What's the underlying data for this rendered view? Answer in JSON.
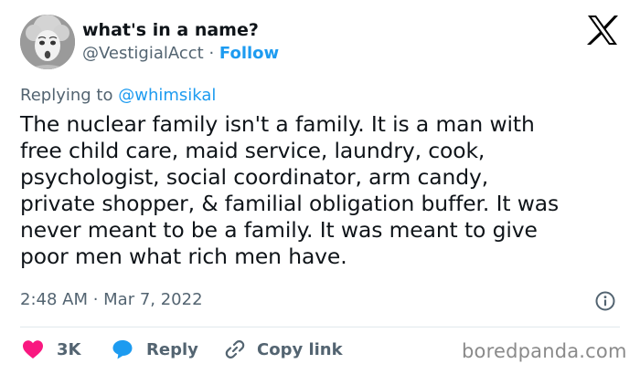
{
  "author": {
    "display_name": "what's in a name?",
    "handle": "@VestigialAcct",
    "separator": " · ",
    "follow_label": "Follow"
  },
  "reply_context": {
    "prefix": "Replying to",
    "mention": "@whimsikal"
  },
  "tweet": {
    "lines": [
      "The nuclear family isn't a family. It is a man with",
      "free child care, maid service, laundry, cook,",
      "psychologist, social coordinator, arm candy,",
      "private shopper, & familial obligation buffer. It was",
      "never meant to be a family. It was meant to give",
      "poor men what rich men have."
    ],
    "timestamp": "2:48 AM · Mar 7, 2022"
  },
  "actions": {
    "like_count": "3K",
    "reply_label": "Reply",
    "copy_label": "Copy link"
  },
  "watermark": "boredpanda.com",
  "colors": {
    "like": "#f91880",
    "reply": "#1d9bf0",
    "link": "#1d9bf0",
    "muted": "#536471",
    "text": "#0f1419"
  },
  "icons": {
    "platform": "x-logo-icon",
    "info": "info-icon",
    "like": "heart-icon",
    "reply": "speech-bubble-icon",
    "copy": "link-icon"
  }
}
